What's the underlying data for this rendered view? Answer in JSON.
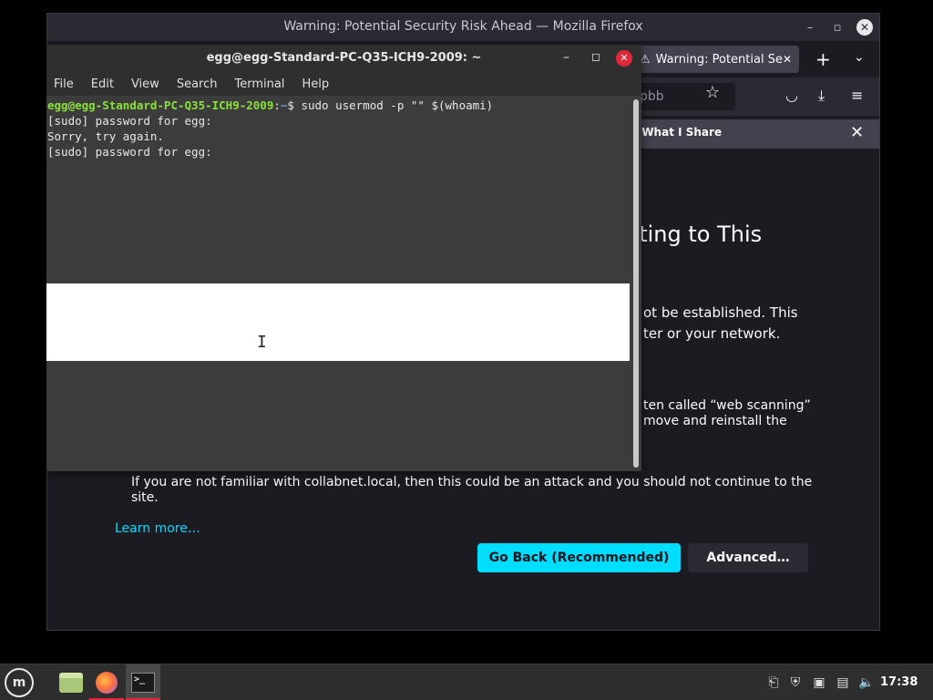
{
  "firefox": {
    "window_title": "Warning: Potential Security Risk Ahead — Mozilla Firefox",
    "tab_title": "Warning: Potential Sec",
    "url_fragment": "pbb",
    "notification_text": "e What I Share",
    "heading_fragment": "cting to This",
    "para1_line1": "ot be established. This",
    "para1_line2": "ter or your network.",
    "para2_line1": "ten called “web scanning”",
    "para2_line2": "move and reinstall the",
    "bullet_text": "If you are not familiar with collabnet.local, then this could be an attack and you should not continue to the site.",
    "learn_more": "Learn more…",
    "go_back_label": "Go Back (Recommended)",
    "advanced_label": "Advanced…"
  },
  "terminal": {
    "title": "egg@egg-Standard-PC-Q35-ICH9-2009: ~",
    "menu": [
      "File",
      "Edit",
      "View",
      "Search",
      "Terminal",
      "Help"
    ],
    "prompt_user": "egg@egg-Standard-PC-Q35-ICH9-2009",
    "prompt_path": "~",
    "command": "$ sudo usermod -p \"\" $(whoami)",
    "lines": [
      "[sudo] password for egg:",
      "Sorry, try again.",
      "[sudo] password for egg:"
    ]
  },
  "taskbar": {
    "clock": "17:38"
  },
  "colors": {
    "accent": "#00ddff",
    "prompt_green": "#8ae234",
    "prompt_blue": "#729fcf",
    "close_red": "#e0283a"
  }
}
